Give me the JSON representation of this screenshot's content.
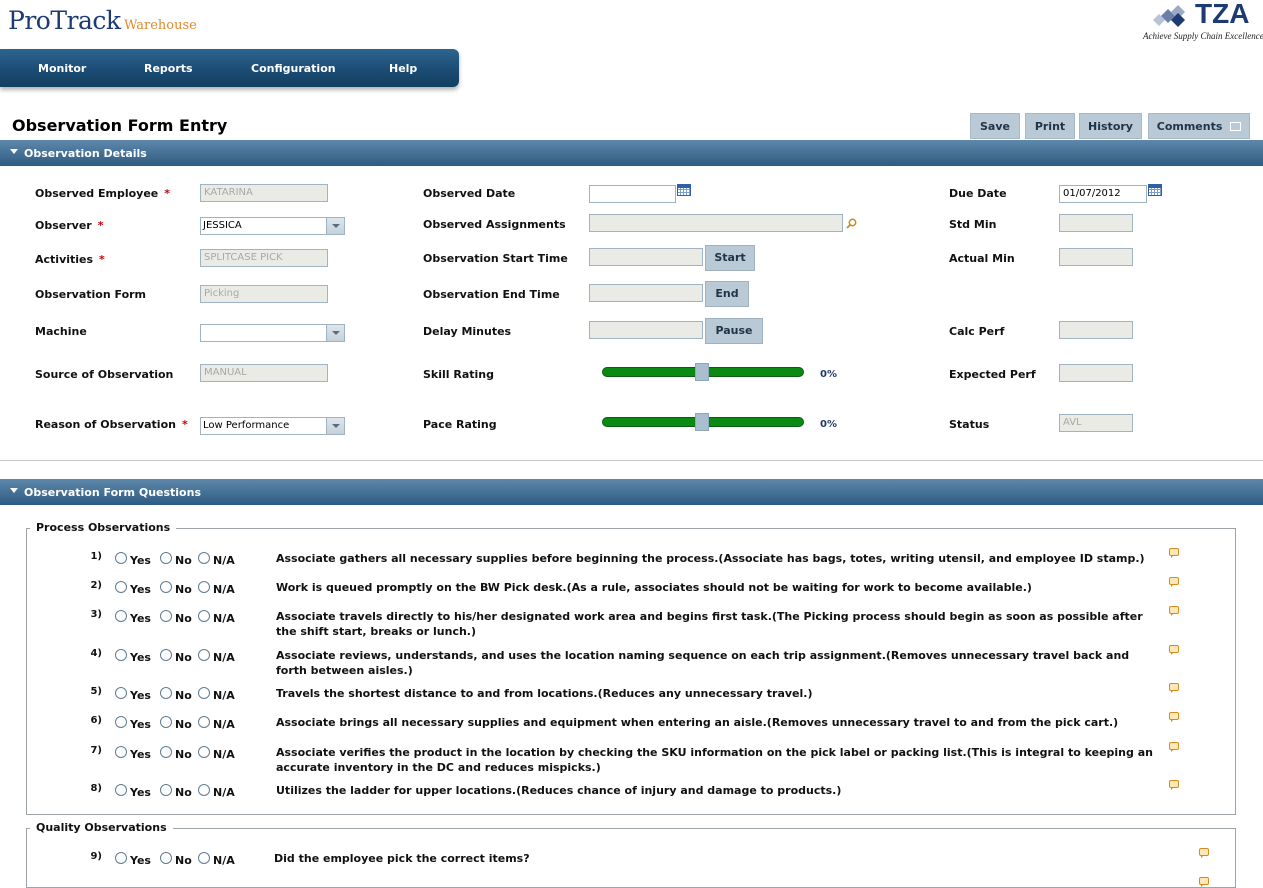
{
  "brand": {
    "name": "ProTrack",
    "sub": "Warehouse",
    "partner": "TZA",
    "tagline": "Achieve Supply Chain Excellence"
  },
  "nav": {
    "items": [
      "Monitor",
      "Reports",
      "Configuration",
      "Help"
    ]
  },
  "page": {
    "title": "Observation Form Entry"
  },
  "toolbar": {
    "save": "Save",
    "print": "Print",
    "history": "History",
    "comments": "Comments"
  },
  "details": {
    "section_title": "Observation Details",
    "observed_employee": {
      "label": "Observed Employee",
      "value": "KATARINA"
    },
    "observer": {
      "label": "Observer",
      "value": "JESSICA"
    },
    "activities": {
      "label": "Activities",
      "value": "SPLITCASE PICK"
    },
    "observation_form": {
      "label": "Observation Form",
      "value": "Picking"
    },
    "machine": {
      "label": "Machine",
      "value": ""
    },
    "source": {
      "label": "Source of Observation",
      "value": "MANUAL"
    },
    "reason": {
      "label": "Reason of Observation",
      "value": "Low Performance"
    },
    "observed_date": {
      "label": "Observed Date",
      "value": ""
    },
    "observed_assignments": {
      "label": "Observed Assignments",
      "value": ""
    },
    "start_time": {
      "label": "Observation Start Time",
      "value": "",
      "button": "Start"
    },
    "end_time": {
      "label": "Observation End Time",
      "value": "",
      "button": "End"
    },
    "delay": {
      "label": "Delay Minutes",
      "value": "",
      "button": "Pause"
    },
    "skill_rating": {
      "label": "Skill Rating",
      "percent": "0%",
      "level": 0.5
    },
    "pace_rating": {
      "label": "Pace Rating",
      "percent": "0%",
      "level": 0.5
    },
    "due_date": {
      "label": "Due Date",
      "value": "01/07/2012"
    },
    "std_min": {
      "label": "Std Min",
      "value": ""
    },
    "actual_min": {
      "label": "Actual Min",
      "value": ""
    },
    "calc_perf": {
      "label": "Calc Perf",
      "value": ""
    },
    "expected_perf": {
      "label": "Expected Perf",
      "value": ""
    },
    "status": {
      "label": "Status",
      "value": "AVL"
    }
  },
  "questions": {
    "section_title": "Observation Form Questions",
    "options": {
      "yes": "Yes",
      "no": "No",
      "na": "N/A"
    },
    "process": {
      "legend": "Process Observations",
      "items": [
        {
          "num": "1)",
          "text": "Associate gathers all necessary supplies before beginning the process.(Associate has bags, totes, writing utensil, and employee ID stamp.)"
        },
        {
          "num": "2)",
          "text": "Work is queued promptly on the BW Pick desk.(As a rule, associates should not be waiting for work to become available.)"
        },
        {
          "num": "3)",
          "text": "Associate travels directly to his/her designated work area and begins first task.(The Picking process should begin as soon as possible after the shift start, breaks or lunch.)"
        },
        {
          "num": "4)",
          "text": "Associate reviews, understands, and uses the location naming sequence on each trip assignment.(Removes unnecessary travel back and forth between aisles.)"
        },
        {
          "num": "5)",
          "text": "Travels the shortest distance to and from locations.(Reduces any unnecessary travel.)"
        },
        {
          "num": "6)",
          "text": "Associate brings all necessary supplies and equipment when entering an aisle.(Removes unnecessary travel to and from the pick cart.)"
        },
        {
          "num": "7)",
          "text": "Associate verifies the product in the location by checking the SKU information on the pick label or packing list.(This is integral to keeping an accurate inventory in the DC and reduces mispicks.)"
        },
        {
          "num": "8)",
          "text": "Utilizes the ladder for upper locations.(Reduces chance of injury and damage to products.)"
        }
      ]
    },
    "quality": {
      "legend": "Quality Observations",
      "items": [
        {
          "num": "9)",
          "text": "Did the employee pick the correct items?"
        }
      ]
    }
  }
}
